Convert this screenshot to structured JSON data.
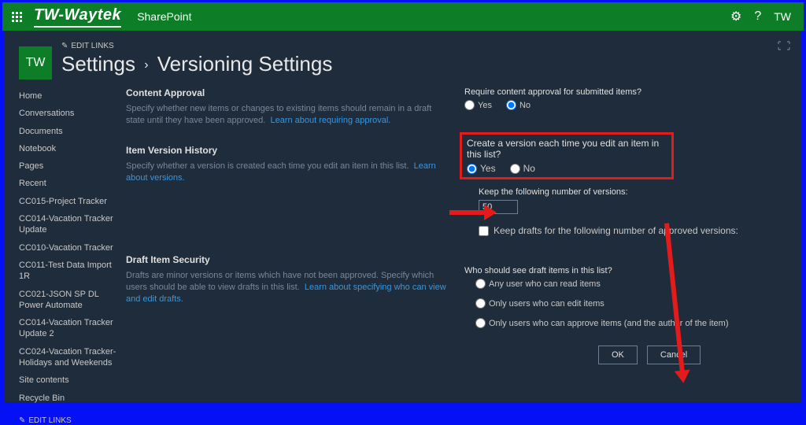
{
  "suiteBar": {
    "brand": "TW-Waytek",
    "appName": "SharePoint",
    "userInitials": "TW"
  },
  "siteTile": "TW",
  "editLinksLabel": "EDIT LINKS",
  "breadcrumb": {
    "settings": "Settings",
    "page": "Versioning Settings"
  },
  "nav": {
    "items": [
      "Home",
      "Conversations",
      "Documents",
      "Notebook",
      "Pages",
      "Recent",
      "CC015-Project Tracker",
      "CC014-Vacation Tracker Update",
      "CC010-Vacation Tracker",
      "CC011-Test Data Import 1R",
      "CC021-JSON SP DL Power Automate",
      "CC014-Vacation Tracker Update 2",
      "CC024-Vacation Tracker- Holidays and Weekends",
      "Site contents",
      "Recycle Bin"
    ]
  },
  "sections": {
    "contentApproval": {
      "title": "Content Approval",
      "desc": "Specify whether new items or changes to existing items should remain in a draft state until they have been approved.",
      "link": "Learn about requiring approval."
    },
    "versionHistory": {
      "title": "Item Version History",
      "desc": "Specify whether a version is created each time you edit an item in this list.",
      "link": "Learn about versions."
    },
    "draftSecurity": {
      "title": "Draft Item Security",
      "desc": "Drafts are minor versions or items which have not been approved. Specify which users should be able to view drafts in this list.",
      "link": "Learn about specifying who can view and edit drafts."
    }
  },
  "controls": {
    "requireApproval": {
      "label": "Require content approval for submitted items?",
      "yes": "Yes",
      "no": "No"
    },
    "createVersion": {
      "label": "Create a version each time you edit an item in this list?",
      "yes": "Yes",
      "no": "No"
    },
    "keepVersions": {
      "label": "Keep the following number of versions:",
      "value": "50"
    },
    "keepDrafts": {
      "label": "Keep drafts for the following number of approved versions:"
    },
    "draftVisibility": {
      "label": "Who should see draft items in this list?",
      "opt1": "Any user who can read items",
      "opt2": "Only users who can edit items",
      "opt3": "Only users who can approve items (and the author of the item)"
    },
    "buttons": {
      "ok": "OK",
      "cancel": "Cancel"
    }
  }
}
